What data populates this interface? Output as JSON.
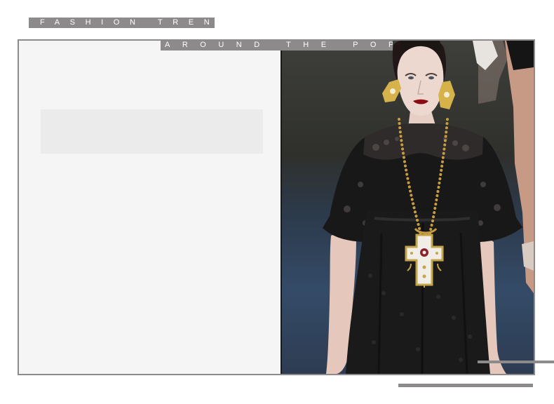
{
  "header": {
    "top_label": "FASHION TRENDS",
    "second_label": "AROUND THE POPULAR"
  },
  "colors": {
    "label_background": "#8c8a8b",
    "label_text": "#ffffff",
    "left_panel": "#f5f5f5",
    "text_block": "#ecebeb",
    "frame_border": "#8c8a8b"
  },
  "icons": {
    "photo": "runway-model-photo"
  }
}
